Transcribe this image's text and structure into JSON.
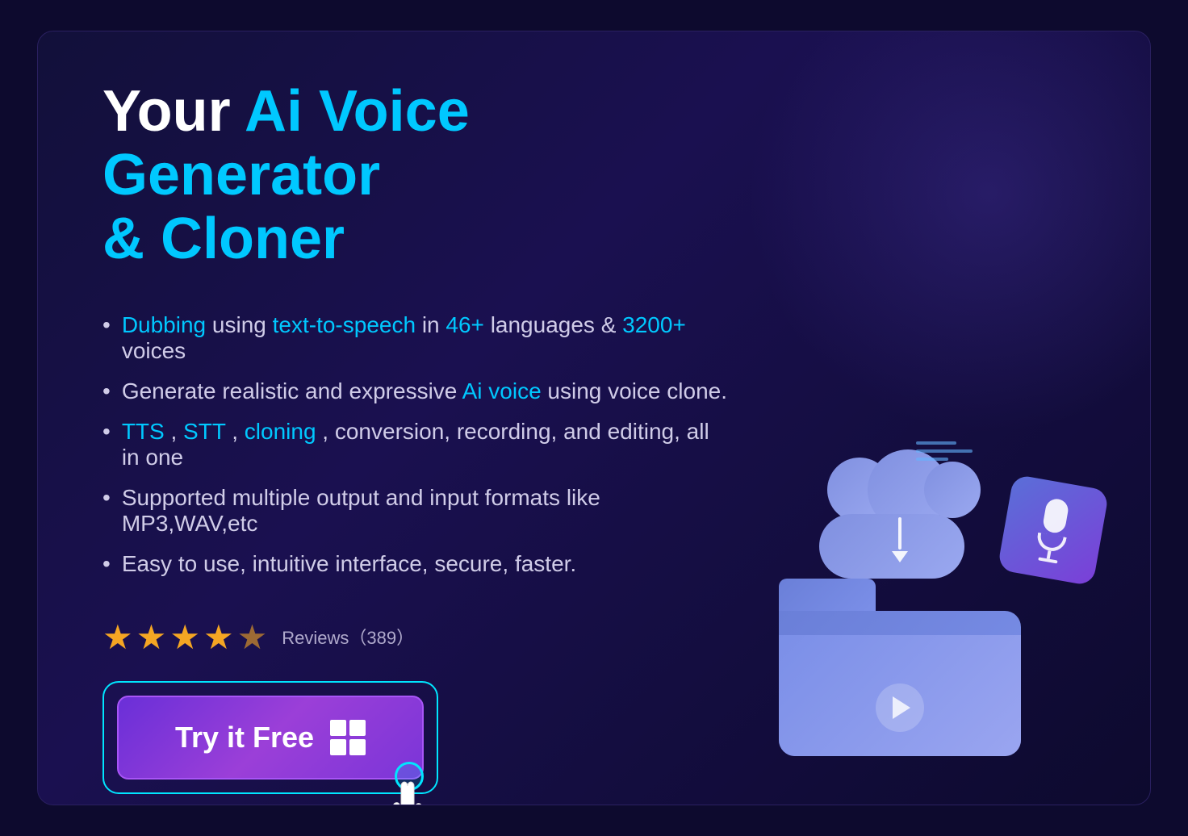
{
  "headline": {
    "prefix": "Your ",
    "highlight": "Ai Voice Generator",
    "suffix_line": "& Cloner"
  },
  "features": [
    {
      "parts": [
        {
          "text": "Dubbing",
          "type": "highlight"
        },
        {
          "text": " using ",
          "type": "normal"
        },
        {
          "text": "text-to-speech",
          "type": "highlight"
        },
        {
          "text": " in ",
          "type": "normal"
        },
        {
          "text": "46+",
          "type": "highlight"
        },
        {
          "text": " languages & ",
          "type": "normal"
        },
        {
          "text": "3200+",
          "type": "highlight"
        },
        {
          "text": " voices",
          "type": "normal"
        }
      ]
    },
    {
      "parts": [
        {
          "text": "Generate realistic and expressive ",
          "type": "normal"
        },
        {
          "text": "Ai voice",
          "type": "highlight"
        },
        {
          "text": " using voice clone.",
          "type": "normal"
        }
      ]
    },
    {
      "parts": [
        {
          "text": "TTS",
          "type": "highlight"
        },
        {
          "text": ", ",
          "type": "normal"
        },
        {
          "text": "STT",
          "type": "highlight"
        },
        {
          "text": ", ",
          "type": "normal"
        },
        {
          "text": "cloning",
          "type": "highlight"
        },
        {
          "text": ", conversion, recording, and editing, all in one",
          "type": "normal"
        }
      ]
    },
    {
      "parts": [
        {
          "text": "Supported multiple output and input formats like MP3,WAV,etc",
          "type": "normal"
        }
      ]
    },
    {
      "parts": [
        {
          "text": "Easy to use, intuitive interface, secure, faster.",
          "type": "normal"
        }
      ]
    }
  ],
  "reviews": {
    "stars_full": 4,
    "stars_half": 1,
    "label": "Reviews（389）"
  },
  "cta": {
    "button_label": "Try it Free",
    "platform_icon": "windows-icon"
  },
  "colors": {
    "background": "#0d0a2e",
    "highlight_cyan": "#00c8ff",
    "button_border_outer": "#00e5ff",
    "button_gradient_start": "#6a2fd8",
    "button_gradient_end": "#9b3fd8",
    "star_color": "#f5a623",
    "illustration_blue": "#7b8fe8"
  }
}
